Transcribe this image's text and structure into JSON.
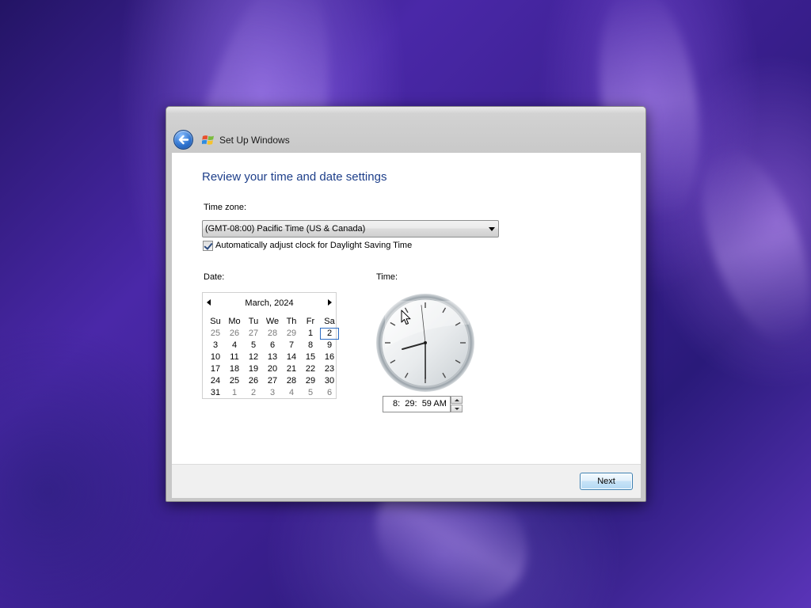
{
  "window": {
    "title": "Set Up Windows"
  },
  "page": {
    "heading": "Review your time and date settings"
  },
  "timezone": {
    "label": "Time zone:",
    "selected": "(GMT-08:00) Pacific Time (US & Canada)"
  },
  "dst": {
    "label": "Automatically adjust clock for Daylight Saving Time",
    "checked": true
  },
  "date": {
    "label": "Date:",
    "month_title": "March, 2024",
    "weekdays": [
      "Su",
      "Mo",
      "Tu",
      "We",
      "Th",
      "Fr",
      "Sa"
    ],
    "weeks": [
      [
        "25",
        "26",
        "27",
        "28",
        "29",
        "1",
        "2"
      ],
      [
        "3",
        "4",
        "5",
        "6",
        "7",
        "8",
        "9"
      ],
      [
        "10",
        "11",
        "12",
        "13",
        "14",
        "15",
        "16"
      ],
      [
        "17",
        "18",
        "19",
        "20",
        "21",
        "22",
        "23"
      ],
      [
        "24",
        "25",
        "26",
        "27",
        "28",
        "29",
        "30"
      ],
      [
        "31",
        "1",
        "2",
        "3",
        "4",
        "5",
        "6"
      ]
    ],
    "selected_day": "2"
  },
  "time": {
    "label": "Time:",
    "hours": 8,
    "minutes": 29,
    "seconds": 59,
    "display": "8:  29:  59 AM"
  },
  "footer": {
    "next_label": "Next"
  },
  "colors": {
    "heading": "#1e3f8a",
    "selection_border": "#2b6cc4",
    "background_accent": "#4a28a8"
  },
  "icons": {
    "back": "back-arrow-icon",
    "logo": "windows-logo-icon",
    "cursor": "mouse-pointer-icon"
  }
}
